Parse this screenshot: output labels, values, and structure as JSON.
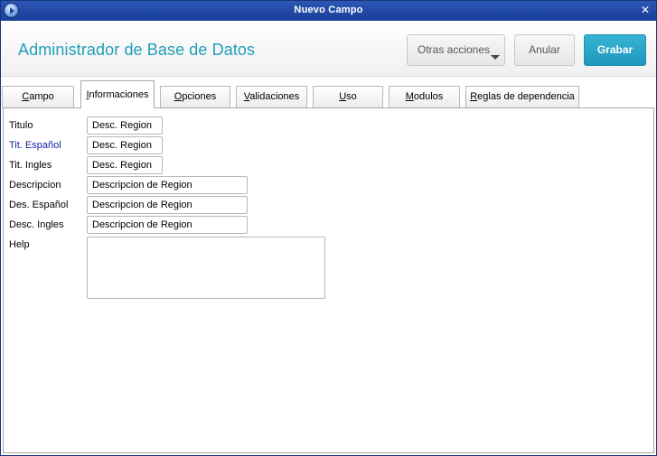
{
  "window": {
    "title": "Nuevo Campo",
    "close_glyph": "✕"
  },
  "header": {
    "app_title": "Administrador de Base de Datos",
    "buttons": {
      "more_actions": "Otras acciones",
      "cancel": "Anular",
      "save": "Grabar"
    },
    "colors": {
      "title": "#20a0b8",
      "save_button": "#1e99bd"
    }
  },
  "tabs": [
    {
      "label": "Campo",
      "mnemonic": "C",
      "rest": "ampo",
      "active": false
    },
    {
      "label": "Informaciones",
      "mnemonic": "I",
      "rest": "nformaciones",
      "active": true
    },
    {
      "label": "Opciones",
      "mnemonic": "O",
      "rest": "pciones",
      "active": false
    },
    {
      "label": "Validaciones",
      "mnemonic": "V",
      "rest": "alidaciones",
      "active": false
    },
    {
      "label": "Uso",
      "mnemonic": "U",
      "rest": "so",
      "active": false
    },
    {
      "label": "Modulos",
      "mnemonic": "M",
      "rest": "odulos",
      "active": false
    },
    {
      "label": "Reglas de dependencia",
      "mnemonic": "R",
      "rest": "eglas de dependencia",
      "active": false
    }
  ],
  "form": {
    "fields": [
      {
        "label": "Titulo",
        "value": "Desc. Region"
      },
      {
        "label": "Tit. Español",
        "value": "Desc. Region"
      },
      {
        "label": "Tit. Ingles",
        "value": "Desc. Region"
      },
      {
        "label": "Descripcion",
        "value": "Descripcion de Region"
      },
      {
        "label": "Des. Español",
        "value": "Descripcion de Region"
      },
      {
        "label": "Desc. Ingles",
        "value": "Descripcion de Region"
      }
    ],
    "help_label": "Help",
    "help_value": ""
  },
  "icons": {
    "app": "app-logo-icon",
    "close": "close-icon",
    "dropdown": "caret-down-icon"
  }
}
